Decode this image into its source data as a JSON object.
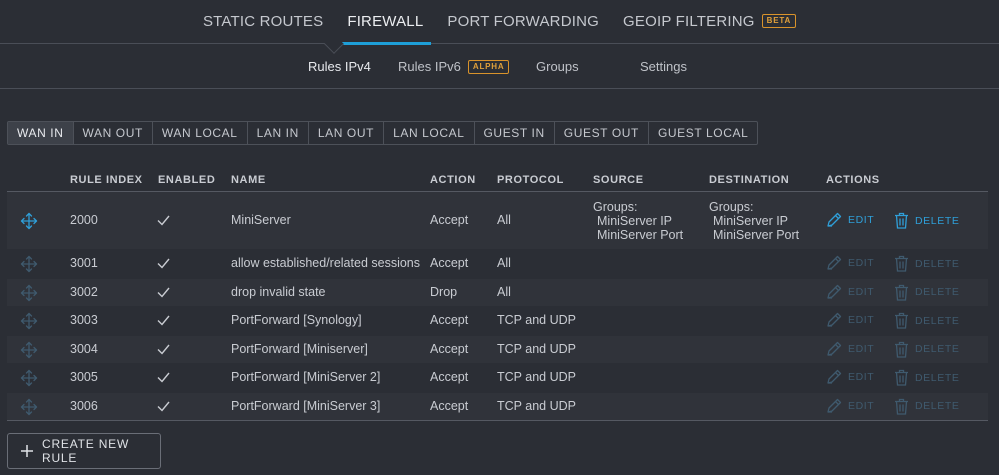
{
  "top_tabs": [
    {
      "label": "STATIC ROUTES",
      "active": false
    },
    {
      "label": "FIREWALL",
      "active": true
    },
    {
      "label": "PORT FORWARDING",
      "active": false
    },
    {
      "label": "GEOIP FILTERING",
      "active": false,
      "badge": "BETA"
    }
  ],
  "sub_tabs": [
    {
      "label": "Rules IPv4",
      "active": true
    },
    {
      "label": "Rules IPv6",
      "badge": "ALPHA"
    },
    {
      "label": "Groups"
    },
    {
      "label": "Settings"
    }
  ],
  "segments": [
    {
      "label": "WAN IN",
      "active": true
    },
    {
      "label": "WAN OUT"
    },
    {
      "label": "WAN LOCAL"
    },
    {
      "label": "LAN IN"
    },
    {
      "label": "LAN OUT"
    },
    {
      "label": "LAN LOCAL"
    },
    {
      "label": "GUEST IN"
    },
    {
      "label": "GUEST OUT"
    },
    {
      "label": "GUEST LOCAL"
    }
  ],
  "table": {
    "headers": {
      "rule_index": "RULE INDEX",
      "enabled": "ENABLED",
      "name": "NAME",
      "action": "ACTION",
      "protocol": "PROTOCOL",
      "source": "SOURCE",
      "destination": "DESTINATION",
      "actions": "ACTIONS"
    },
    "edit_label": "EDIT",
    "delete_label": "DELETE",
    "rows": [
      {
        "index": "2000",
        "enabled": true,
        "name": "MiniServer",
        "action": "Accept",
        "protocol": "All",
        "source": {
          "title": "Groups:",
          "items": [
            "MiniServer IP",
            "MiniServer Port"
          ]
        },
        "destination": {
          "title": "Groups:",
          "items": [
            "MiniServer IP",
            "MiniServer Port"
          ]
        },
        "editable": true
      },
      {
        "index": "3001",
        "enabled": true,
        "name": "allow established/related sessions",
        "action": "Accept",
        "protocol": "All",
        "editable": false
      },
      {
        "index": "3002",
        "enabled": true,
        "name": "drop invalid state",
        "action": "Drop",
        "protocol": "All",
        "editable": false
      },
      {
        "index": "3003",
        "enabled": true,
        "name": "PortForward [Synology]",
        "action": "Accept",
        "protocol": "TCP and UDP",
        "editable": false
      },
      {
        "index": "3004",
        "enabled": true,
        "name": "PortForward [Miniserver]",
        "action": "Accept",
        "protocol": "TCP and UDP",
        "editable": false
      },
      {
        "index": "3005",
        "enabled": true,
        "name": "PortForward [MiniServer 2]",
        "action": "Accept",
        "protocol": "TCP and UDP",
        "editable": false
      },
      {
        "index": "3006",
        "enabled": true,
        "name": "PortForward [MiniServer 3]",
        "action": "Accept",
        "protocol": "TCP and UDP",
        "editable": false
      }
    ]
  },
  "create_button": {
    "label": "CREATE NEW RULE"
  },
  "icons": {
    "move": "move-arrows-icon",
    "check": "check-icon",
    "edit": "pencil-icon",
    "delete": "trash-icon",
    "plus": "plus-icon"
  },
  "colors": {
    "accent": "#1e9fd8",
    "badge": "#d9932b",
    "background": "#2b2e35"
  }
}
